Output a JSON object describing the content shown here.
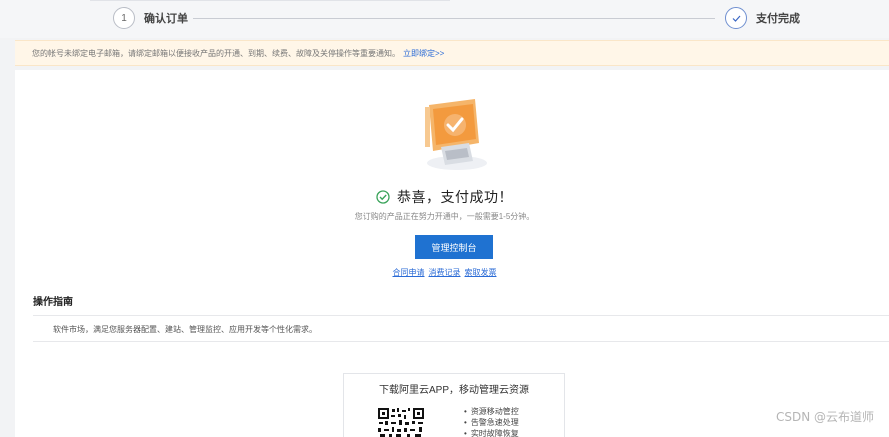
{
  "steps": [
    {
      "number": "1",
      "label": "确认订单",
      "state": "done"
    },
    {
      "icon": "check-icon",
      "label": "支付完成",
      "state": "current"
    }
  ],
  "notice": {
    "text": "您的帐号未绑定电子邮箱，请绑定邮箱以便接收产品的开通、到期、续费、故障及关停操作等重要通知。",
    "link": "立即绑定>>"
  },
  "result": {
    "title": "恭喜，支付成功！",
    "subtitle": "您订购的产品正在努力开通中，一般需要1-5分钟。",
    "manage_button": "管理控制台",
    "links": [
      "合同申请",
      "消费记录",
      "索取发票"
    ]
  },
  "guide": {
    "title": "操作指南",
    "text": "软件市场，满足您服务器配置、建站、管理监控、应用开发等个性化需求。"
  },
  "app": {
    "title": "下载阿里云APP，移动管理云资源",
    "features": [
      "资源移动管控",
      "告警急速处理",
      "实时故障恢复"
    ]
  },
  "watermark": "CSDN @云布道师",
  "colors": {
    "accent": "#1f72d1",
    "notice_bg": "#fff6e8",
    "success_green": "#3aa35a",
    "illustration_orange": "#f39a3e"
  }
}
